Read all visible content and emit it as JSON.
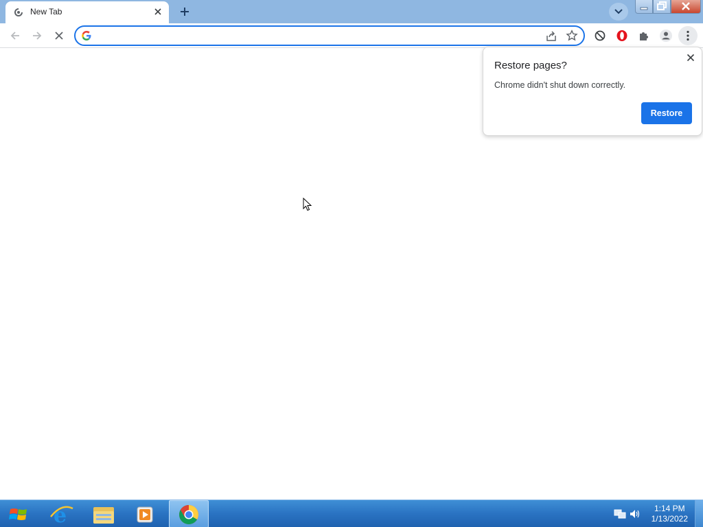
{
  "browser": {
    "tab": {
      "title": "New Tab"
    },
    "omnibox": {
      "value": ""
    }
  },
  "restore_bubble": {
    "title": "Restore pages?",
    "message": "Chrome didn't shut down correctly.",
    "button_label": "Restore"
  },
  "taskbar": {
    "clock": {
      "time": "1:14 PM",
      "date": "1/13/2022"
    },
    "apps": [
      "internet-explorer",
      "file-explorer",
      "media-player",
      "chrome"
    ]
  },
  "colors": {
    "accent": "#1a73e8",
    "tabstrip": "#8fb7e1",
    "taskbar": "#2a73c2",
    "close_button": "#c9472f"
  }
}
